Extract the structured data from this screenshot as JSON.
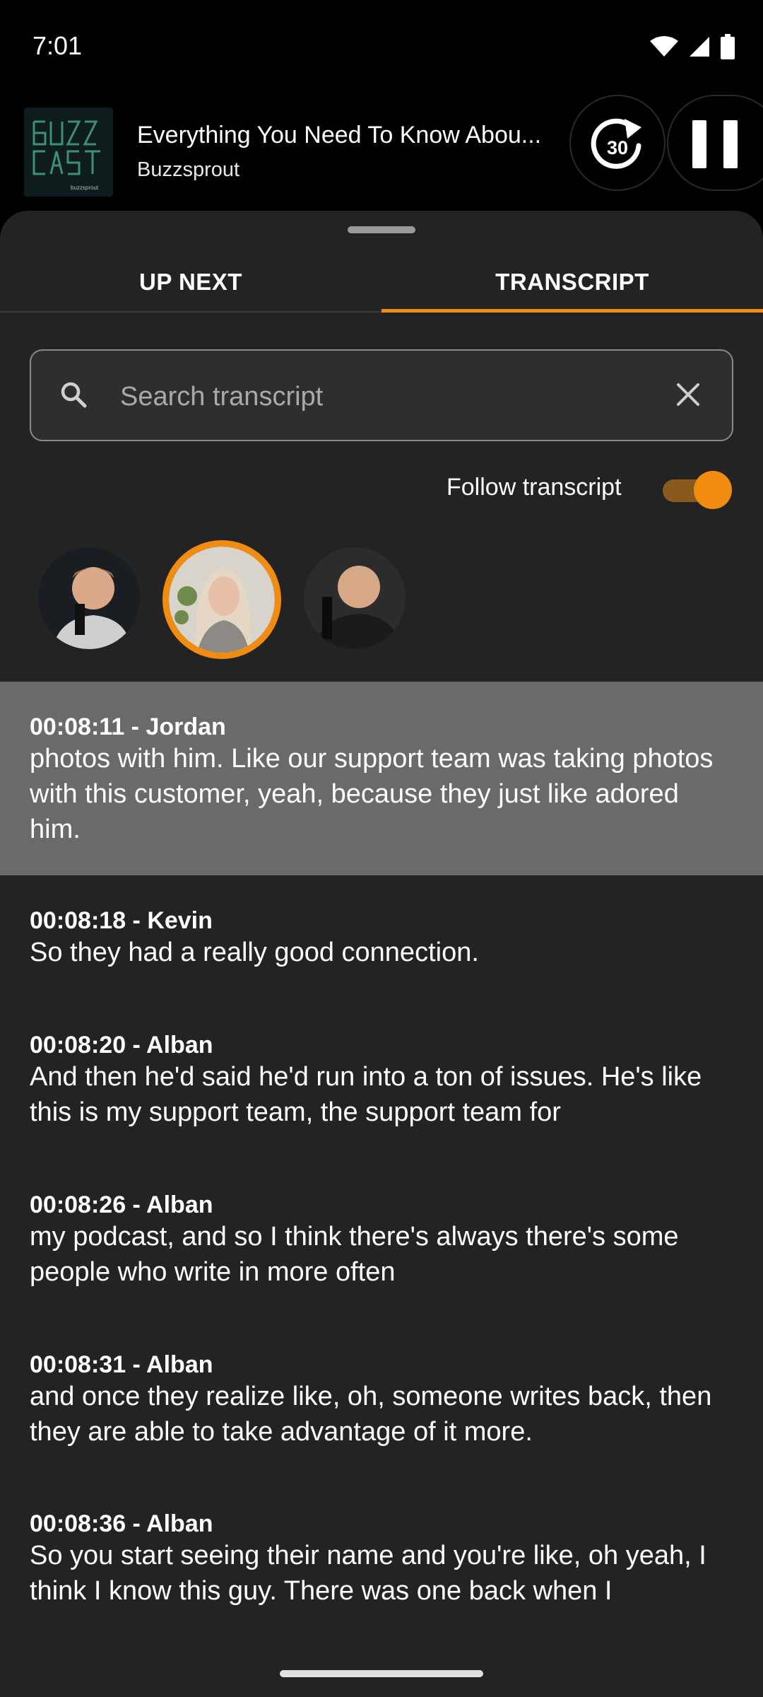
{
  "status": {
    "time": "7:01"
  },
  "player": {
    "episode_title": "Everything You Need To Know Abou...",
    "show_name": "Buzzsprout",
    "skip_seconds": "30",
    "artwork_icon": "buzzcast-artwork"
  },
  "tabs": [
    {
      "label": "UP NEXT",
      "active": false
    },
    {
      "label": "TRANSCRIPT",
      "active": true
    }
  ],
  "search": {
    "placeholder": "Search transcript",
    "value": ""
  },
  "follow": {
    "label": "Follow transcript",
    "enabled": true
  },
  "speakers": [
    {
      "name": "speaker-1",
      "selected": false
    },
    {
      "name": "speaker-2",
      "selected": true
    },
    {
      "name": "speaker-3",
      "selected": false
    }
  ],
  "segments": [
    {
      "head": "00:08:11 - Jordan",
      "text": "photos with him. Like our support team was taking photos with this customer, yeah, because they just like adored him.",
      "highlight": true
    },
    {
      "head": "00:08:18 - Kevin",
      "text": "So they had a really good connection.",
      "highlight": false
    },
    {
      "head": "00:08:20 - Alban",
      "text": "And then he'd said he'd run into a ton of issues. He's like this is my support team, the support team for",
      "highlight": false
    },
    {
      "head": "00:08:26 - Alban",
      "text": "my podcast, and so I think there's always there's some people who write in more often",
      "highlight": false
    },
    {
      "head": "00:08:31 - Alban",
      "text": "and once they realize like, oh, someone writes back, then they are able to take advantage of it more.",
      "highlight": false
    },
    {
      "head": "00:08:36 - Alban",
      "text": "So you start seeing their name and you're like, oh yeah, I think I know this guy. There was one back when I",
      "highlight": false
    }
  ],
  "colors": {
    "accent": "#f28c10",
    "sheet": "#232323",
    "highlight_row": "#6a6a6a"
  }
}
